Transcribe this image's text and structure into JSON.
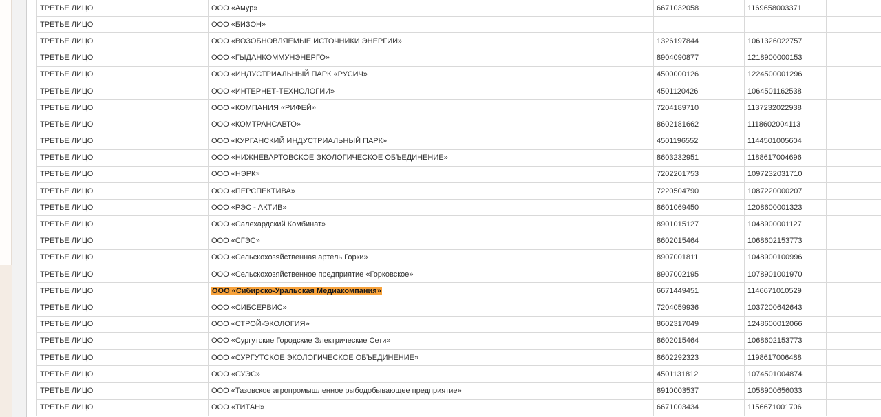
{
  "highlight_color": "#f7a23b",
  "rows": [
    {
      "role": "ТРЕТЬЕ ЛИЦО",
      "name": "ООО «Амур»",
      "inn": "6671032058",
      "kpp": "",
      "ogrn": "1169658003371",
      "extra": ""
    },
    {
      "role": "ТРЕТЬЕ ЛИЦО",
      "name": "ООО «БИЗОН»",
      "inn": "",
      "kpp": "",
      "ogrn": "",
      "extra": ""
    },
    {
      "role": "ТРЕТЬЕ ЛИЦО",
      "name": "ООО «ВОЗОБНОВЛЯЕМЫЕ ИСТОЧНИКИ ЭНЕРГИИ»",
      "inn": "1326197844",
      "kpp": "",
      "ogrn": "1061326022757",
      "extra": ""
    },
    {
      "role": "ТРЕТЬЕ ЛИЦО",
      "name": "ООО «ГЫДАНКОММУНЭНЕРГО»",
      "inn": "8904090877",
      "kpp": "",
      "ogrn": "1218900000153",
      "extra": ""
    },
    {
      "role": "ТРЕТЬЕ ЛИЦО",
      "name": "ООО «ИНДУСТРИАЛЬНЫЙ ПАРК «РУСИЧ»",
      "inn": "4500000126",
      "kpp": "",
      "ogrn": "1224500001296",
      "extra": ""
    },
    {
      "role": "ТРЕТЬЕ ЛИЦО",
      "name": "ООО «ИНТЕРНЕТ-ТЕХНОЛОГИИ»",
      "inn": "4501120426",
      "kpp": "",
      "ogrn": "1064501162538",
      "extra": ""
    },
    {
      "role": "ТРЕТЬЕ ЛИЦО",
      "name": "ООО «КОМПАНИЯ «РИФЕЙ»",
      "inn": "7204189710",
      "kpp": "",
      "ogrn": "1137232022938",
      "extra": ""
    },
    {
      "role": "ТРЕТЬЕ ЛИЦО",
      "name": "ООО «КОМТРАНСАВТО»",
      "inn": "8602181662",
      "kpp": "",
      "ogrn": "1118602004113",
      "extra": ""
    },
    {
      "role": "ТРЕТЬЕ ЛИЦО",
      "name": "ООО «КУРГАНСКИЙ ИНДУСТРИАЛЬНЫЙ ПАРК»",
      "inn": "4501196552",
      "kpp": "",
      "ogrn": "1144501005604",
      "extra": ""
    },
    {
      "role": "ТРЕТЬЕ ЛИЦО",
      "name": "ООО «НИЖНЕВАРТОВСКОЕ ЭКОЛОГИЧЕСКОЕ ОБЪЕДИНЕНИЕ»",
      "inn": "8603232951",
      "kpp": "",
      "ogrn": "1188617004696",
      "extra": ""
    },
    {
      "role": "ТРЕТЬЕ ЛИЦО",
      "name": "ООО «НЭРК»",
      "inn": "7202201753",
      "kpp": "",
      "ogrn": "1097232031710",
      "extra": ""
    },
    {
      "role": "ТРЕТЬЕ ЛИЦО",
      "name": "ООО «ПЕРСПЕКТИВА»",
      "inn": "7220504790",
      "kpp": "",
      "ogrn": "1087220000207",
      "extra": ""
    },
    {
      "role": "ТРЕТЬЕ ЛИЦО",
      "name": "ООО «РЭС - АКТИВ»",
      "inn": "8601069450",
      "kpp": "",
      "ogrn": "1208600001323",
      "extra": ""
    },
    {
      "role": "ТРЕТЬЕ ЛИЦО",
      "name": "ООО «Салехардский Комбинат»",
      "inn": "8901015127",
      "kpp": "",
      "ogrn": "1048900001127",
      "extra": ""
    },
    {
      "role": "ТРЕТЬЕ ЛИЦО",
      "name": "ООО «СГЭС»",
      "inn": "8602015464",
      "kpp": "",
      "ogrn": "1068602153773",
      "extra": ""
    },
    {
      "role": "ТРЕТЬЕ ЛИЦО",
      "name": "ООО «Сельскохозяйственная артель Горки»",
      "inn": "8907001811",
      "kpp": "",
      "ogrn": "1048900100996",
      "extra": ""
    },
    {
      "role": "ТРЕТЬЕ ЛИЦО",
      "name": "ООО «Сельскохозяйственное предприятие «Горковское»",
      "inn": "8907002195",
      "kpp": "",
      "ogrn": "1078901001970",
      "extra": ""
    },
    {
      "role": "ТРЕТЬЕ ЛИЦО",
      "name": "ООО «Сибирско-Уральская Медиакомпания»",
      "inn": "6671449451",
      "kpp": "",
      "ogrn": "1146671010529",
      "extra": "",
      "highlighted": true
    },
    {
      "role": "ТРЕТЬЕ ЛИЦО",
      "name": "ООО «СИБСЕРВИС»",
      "inn": "7204059936",
      "kpp": "",
      "ogrn": "1037200642643",
      "extra": ""
    },
    {
      "role": "ТРЕТЬЕ ЛИЦО",
      "name": "ООО «СТРОЙ-ЭКОЛОГИЯ»",
      "inn": "8602317049",
      "kpp": "",
      "ogrn": "1248600012066",
      "extra": ""
    },
    {
      "role": "ТРЕТЬЕ ЛИЦО",
      "name": "ООО «Сургутские Городские Электрические Сети»",
      "inn": "8602015464",
      "kpp": "",
      "ogrn": "1068602153773",
      "extra": ""
    },
    {
      "role": "ТРЕТЬЕ ЛИЦО",
      "name": "ООО «СУРГУТСКОЕ ЭКОЛОГИЧЕСКОЕ ОБЪЕДИНЕНИЕ»",
      "inn": "8602292323",
      "kpp": "",
      "ogrn": "1198617006488",
      "extra": ""
    },
    {
      "role": "ТРЕТЬЕ ЛИЦО",
      "name": "ООО «СУЭС»",
      "inn": "4501131812",
      "kpp": "",
      "ogrn": "1074501004874",
      "extra": ""
    },
    {
      "role": "ТРЕТЬЕ ЛИЦО",
      "name": "ООО «Тазовское агропромышленное рыбодобывающее предприятие»",
      "inn": "8910003537",
      "kpp": "",
      "ogrn": "1058900656033",
      "extra": ""
    },
    {
      "role": "ТРЕТЬЕ ЛИЦО",
      "name": "ООО «ТИТАН»",
      "inn": "6671003434",
      "kpp": "",
      "ogrn": "1156671001706",
      "extra": ""
    }
  ]
}
